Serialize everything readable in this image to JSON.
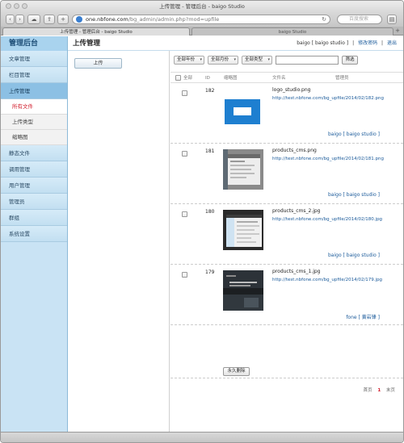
{
  "browser": {
    "window_title": "上传管理 - 管理后台 - baigo Studio",
    "url_host": "one.nbfone.com",
    "url_path": "/bg_admin/admin.php?mod=upfile",
    "search_placeholder": "百度搜索",
    "tabs": [
      {
        "label": "上传管理 - 管理后台 - baigo Studio"
      },
      {
        "label": "baigo Studio"
      }
    ]
  },
  "brand": "管理后台",
  "header": {
    "title": "上传管理",
    "user": "baigo [ baigo studio ]",
    "sep": "|",
    "change_password": "修改密码",
    "logout": "退出"
  },
  "sidebar": {
    "items": [
      {
        "label": "文章管理"
      },
      {
        "label": "栏目管理"
      },
      {
        "label": "上传管理"
      }
    ],
    "subitems": [
      {
        "label": "所有文件"
      },
      {
        "label": "上传类型"
      },
      {
        "label": "缩略图"
      }
    ],
    "items_after": [
      {
        "label": "静态文件"
      },
      {
        "label": "调用管理"
      },
      {
        "label": "用户管理"
      },
      {
        "label": "管理员"
      },
      {
        "label": "群组"
      },
      {
        "label": "系统设置"
      }
    ]
  },
  "upload_button": "上传",
  "filters": {
    "year": "全部年份",
    "month": "全部月份",
    "type": "全部类型",
    "submit": "筛选",
    "keyword": ""
  },
  "table": {
    "headers": {
      "all": "全部",
      "id": "ID",
      "thumb": "缩略图",
      "filename": "文件名",
      "admin": "管理员"
    },
    "rows": [
      {
        "id": "182",
        "name": "logo_studio.png",
        "url": "http://test.nbfone.com/bg_upfile/2014/02/182.png",
        "owner": "baigo [ baigo studio ]",
        "thumb": "logo"
      },
      {
        "id": "181",
        "name": "products_cms.png",
        "url": "http://test.nbfone.com/bg_upfile/2014/02/181.png",
        "owner": "baigo [ baigo studio ]",
        "thumb": "screen"
      },
      {
        "id": "180",
        "name": "products_cms_2.jpg",
        "url": "http://test.nbfone.com/bg_upfile/2014/02/180.jpg",
        "owner": "baigo [ baigo studio ]",
        "thumb": "screen2"
      },
      {
        "id": "179",
        "name": "products_cms_1.jpg",
        "url": "http://test.nbfone.com/bg_upfile/2014/02/179.jpg",
        "owner": "fone [ 黄岩锋 ]",
        "thumb": "dark"
      }
    ]
  },
  "delete_button": "永久删除",
  "pager": {
    "first": "首页",
    "current": "1",
    "last": "末页"
  },
  "colors": {
    "accent": "#1a5a9a",
    "sidebar": "#c9e3f4",
    "active": "#d2202f",
    "logo_blue": "#1e7fd0"
  }
}
